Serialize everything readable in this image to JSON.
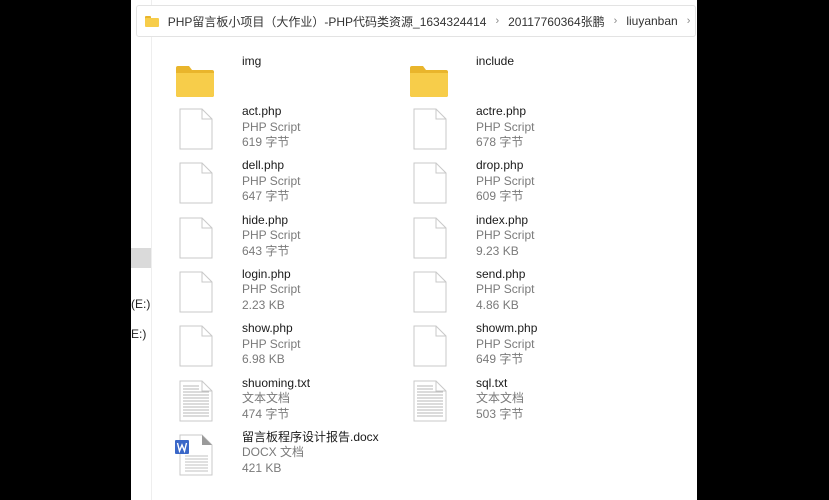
{
  "window": {
    "address_bar": {
      "overflow_label": "«",
      "crumbs": [
        "PHP留言板小项目（大作业）-PHP代码类资源_1634324414",
        "20117760364张鹏",
        "liuyanban"
      ],
      "separator": "›"
    },
    "sidebar": {
      "drives": [
        "(E:)",
        "E:)"
      ]
    },
    "items": [
      {
        "name": "img",
        "type": "folder"
      },
      {
        "name": "include",
        "type": "folder"
      },
      {
        "name": "act.php",
        "kind": "PHP Script",
        "size": "619 字节",
        "type": "file"
      },
      {
        "name": "actre.php",
        "kind": "PHP Script",
        "size": "678 字节",
        "type": "file"
      },
      {
        "name": "dell.php",
        "kind": "PHP Script",
        "size": "647 字节",
        "type": "file"
      },
      {
        "name": "drop.php",
        "kind": "PHP Script",
        "size": "609 字节",
        "type": "file"
      },
      {
        "name": "hide.php",
        "kind": "PHP Script",
        "size": "643 字节",
        "type": "file"
      },
      {
        "name": "index.php",
        "kind": "PHP Script",
        "size": "9.23 KB",
        "type": "file"
      },
      {
        "name": "login.php",
        "kind": "PHP Script",
        "size": "2.23 KB",
        "type": "file"
      },
      {
        "name": "send.php",
        "kind": "PHP Script",
        "size": "4.86 KB",
        "type": "file"
      },
      {
        "name": "show.php",
        "kind": "PHP Script",
        "size": "6.98 KB",
        "type": "file"
      },
      {
        "name": "showm.php",
        "kind": "PHP Script",
        "size": "649 字节",
        "type": "file"
      },
      {
        "name": "shuoming.txt",
        "kind": "文本文档",
        "size": "474 字节",
        "type": "text"
      },
      {
        "name": "sql.txt",
        "kind": "文本文档",
        "size": "503 字节",
        "type": "text"
      },
      {
        "name": "留言板程序设计报告.docx",
        "kind": "DOCX 文档",
        "size": "421 KB",
        "type": "docx"
      }
    ],
    "colors": {
      "folder": "#f7cd4a",
      "folder_tab": "#e9b52c",
      "word_badge": "#3a67c8"
    }
  }
}
